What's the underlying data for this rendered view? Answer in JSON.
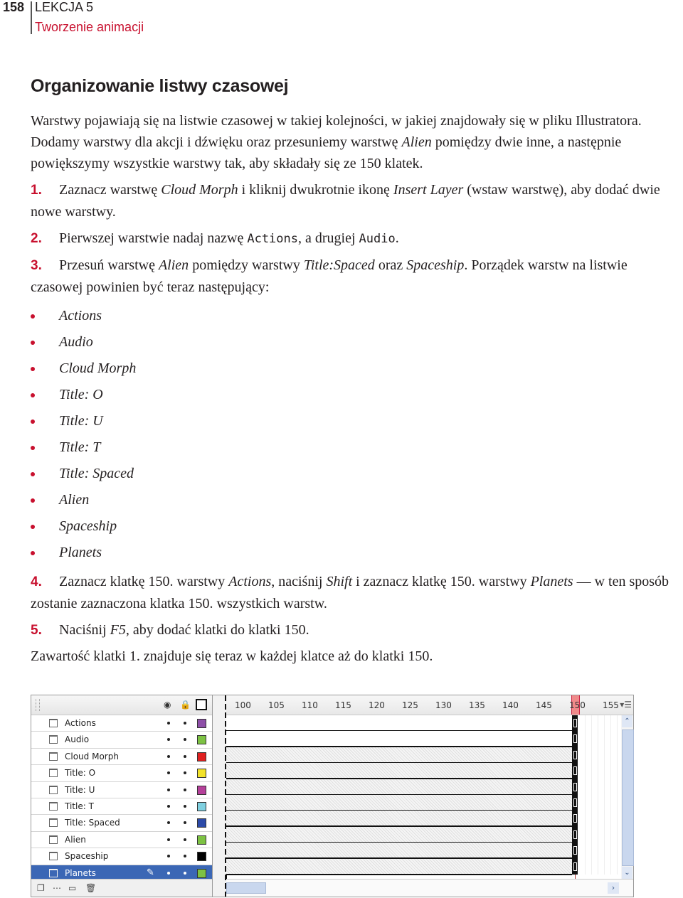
{
  "header": {
    "page_number": "158",
    "lesson": "LEKCJA 5",
    "chapter": "Tworzenie animacji",
    "chapter_color": "#c8102e"
  },
  "section": {
    "title": "Organizowanie listwy czasowej",
    "intro": {
      "part1": "Warstwy pojawiają się na listwie czasowej w takiej kolejności, w jakiej znajdowały się w pliku Illustratora. Dodamy warstwy dla akcji i dźwięku oraz przesuniemy warstwę ",
      "italic1": "Alien",
      "part2": " pomiędzy dwie inne, a następnie powiększymy wszystkie warstwy tak, aby składały się ze 150 klatek."
    },
    "steps": [
      {
        "number": "1.",
        "t1": "Zaznacz warstwę ",
        "i1": "Cloud Morph",
        "t2": " i kliknij dwukrotnie ikonę ",
        "i2": "Insert Layer",
        "t3": " (wstaw warstwę), aby dodać dwie nowe warstwy."
      },
      {
        "number": "2.",
        "t1": "Pierwszej warstwie nadaj nazwę ",
        "m1": "Actions",
        "t2": ", a drugiej ",
        "m2": "Audio",
        "t3": "."
      },
      {
        "number": "3.",
        "t1": "Przesuń warstwę ",
        "i1": "Alien",
        "t2": " pomiędzy warstwy ",
        "i2": "Title:Spaced",
        "t3": " oraz ",
        "i3": "Spaceship",
        "t4": ". Porządek warstw na listwie czasowej powinien być teraz następujący:"
      },
      {
        "number": "4.",
        "t1": "Zaznacz klatkę 150. warstwy ",
        "i1": "Actions",
        "t2": ", naciśnij ",
        "i2": "Shift",
        "t3": " i zaznacz klatkę 150. warstwy ",
        "i3": "Planets",
        "t4": " — w ten sposób zostanie zaznaczona klatka 150. wszystkich warstw."
      },
      {
        "number": "5.",
        "t1": "Naciśnij ",
        "i1": "F5",
        "t2": ", aby dodać klatki do klatki 150."
      }
    ],
    "layer_order": [
      "Actions",
      "Audio",
      "Cloud Morph",
      "Title: O",
      "Title: U",
      "Title: T",
      "Title: Spaced",
      "Alien",
      "Spaceship",
      "Planets"
    ],
    "conclusion": "Zawartość klatki 1. znajduje się teraz w każdej klatce aż do klatki 150."
  },
  "timeline": {
    "header_icons": [
      "eye-icon",
      "lock-icon",
      "outline-icon"
    ],
    "layers": [
      {
        "name": "Actions",
        "color": "#8e4fa8",
        "selected": false
      },
      {
        "name": "Audio",
        "color": "#7dc243",
        "selected": false
      },
      {
        "name": "Cloud Morph",
        "color": "#e02020",
        "selected": false
      },
      {
        "name": "Title: O",
        "color": "#f2e22a",
        "selected": false
      },
      {
        "name": "Title: U",
        "color": "#b5409a",
        "selected": false
      },
      {
        "name": "Title: T",
        "color": "#7fd0e0",
        "selected": false
      },
      {
        "name": "Title: Spaced",
        "color": "#2c4aa8",
        "selected": false
      },
      {
        "name": "Alien",
        "color": "#7dc243",
        "selected": false
      },
      {
        "name": "Spaceship",
        "color": "#000000",
        "selected": false
      },
      {
        "name": "Planets",
        "color": "#7dc243",
        "selected": true
      }
    ],
    "ruler_ticks": [
      "100",
      "105",
      "110",
      "115",
      "120",
      "125",
      "130",
      "135",
      "140",
      "145",
      "150",
      "155"
    ],
    "current_frame": "150",
    "footer_icons": [
      "new-layer-icon",
      "motion-guide-icon",
      "new-folder-icon",
      "delete-icon"
    ]
  }
}
